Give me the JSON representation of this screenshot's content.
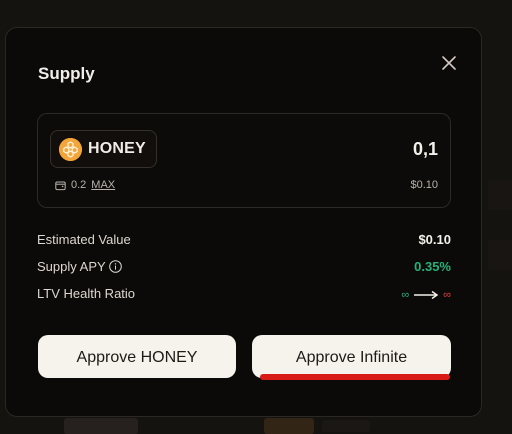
{
  "modal": {
    "title": "Supply"
  },
  "token": {
    "name": "HONEY",
    "icon": "honey-token-icon"
  },
  "amount": {
    "value": "0,1"
  },
  "balance": {
    "value": "0.2",
    "max_label": "MAX",
    "usd_value": "$0.10"
  },
  "info": {
    "estimated_value": {
      "label": "Estimated Value",
      "value": "$0.10"
    },
    "supply_apy": {
      "label": "Supply APY",
      "value": "0.35%"
    },
    "ltv_health": {
      "label": "LTV Health Ratio",
      "from": "∞",
      "to": "∞"
    }
  },
  "buttons": {
    "approve_label": "Approve HONEY",
    "infinite_label": "Approve Infinite"
  },
  "colors": {
    "accent_green": "#27b07a",
    "accent_red": "#e0403c",
    "underline_red": "#d81b16",
    "token_orange": "#f3a53a"
  }
}
